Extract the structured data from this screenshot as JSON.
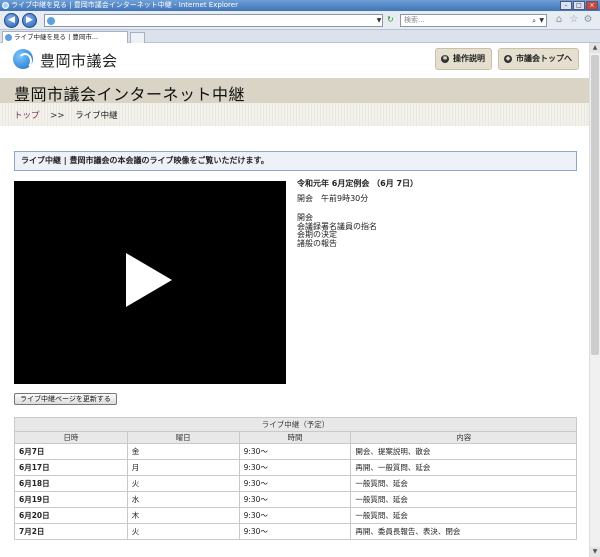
{
  "browser": {
    "window_title": "ライブ中継を見る | 豊岡市議会インターネット中継 - Internet Explorer",
    "search_placeholder": "検索...",
    "tab_label": "ライブ中継を見る | 豊岡市..."
  },
  "header": {
    "site_name": "豊岡市議会",
    "help_button": "操作説明",
    "top_button": "市議会トップへ"
  },
  "page": {
    "title": "豊岡市議会インターネット中継",
    "breadcrumb": {
      "home": "トップ",
      "separator": ">>",
      "current": "ライブ中継"
    },
    "notice": "ライブ中継 | 豊岡市議会の本会議のライブ映像をご覧いただけます。",
    "refresh_button": "ライブ中継ページを更新する"
  },
  "session_info": {
    "session": "令和元年 6月定例会 （6月 7日）",
    "opening": "開会　午前9時30分",
    "agenda": [
      "開会",
      "会議録署名議員の指名",
      "会期の決定",
      "諸般の報告"
    ]
  },
  "schedule": {
    "caption": "ライブ中継（予定）",
    "headers": [
      "日時",
      "曜日",
      "時間",
      "内容"
    ],
    "rows": [
      [
        "6月7日",
        "金",
        "9:30～",
        "開会、提案説明、散会"
      ],
      [
        "6月17日",
        "月",
        "9:30～",
        "再開、一般質問、延会"
      ],
      [
        "6月18日",
        "火",
        "9:30～",
        "一般質問、延会"
      ],
      [
        "6月19日",
        "水",
        "9:30～",
        "一般質問、延会"
      ],
      [
        "6月20日",
        "木",
        "9:30～",
        "一般質問、延会"
      ],
      [
        "7月2日",
        "火",
        "9:30～",
        "再開、委員長報告、表決、閉会"
      ]
    ]
  }
}
